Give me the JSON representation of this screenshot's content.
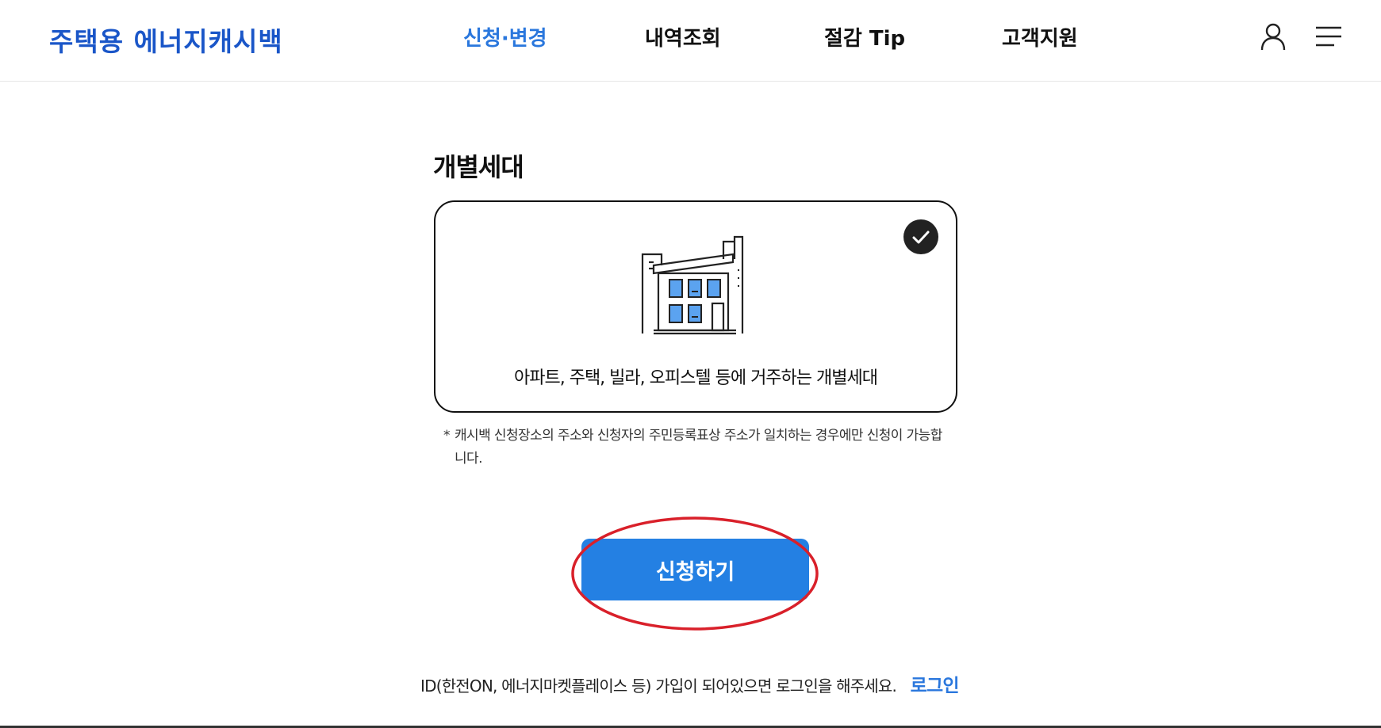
{
  "header": {
    "logo": "주택용 에너지캐시백",
    "nav": [
      {
        "label": "신청·변경",
        "active": true
      },
      {
        "label": "내역조회",
        "active": false
      },
      {
        "label": "절감 Tip",
        "active": false
      },
      {
        "label": "고객지원",
        "active": false
      }
    ],
    "icons": [
      "user-icon",
      "hamburger-menu-icon"
    ]
  },
  "main": {
    "section_title": "개별세대",
    "card": {
      "icon": "building-icon",
      "selected": true,
      "description": "아파트, 주택, 빌라, 오피스텔 등에 거주하는 개별세대"
    },
    "note_star": "*",
    "note": "캐시백 신청장소의 주소와 신청자의 주민등록표상 주소가 일치하는 경우에만 신청이 가능합니다.",
    "apply_button": "신청하기",
    "login_prompt": "ID(한전ON, 에너지마켓플레이스 등) 가입이 되어있으면 로그인을 해주세요.",
    "login_link": "로그인"
  },
  "colors": {
    "brand": "#1a56c8",
    "accent": "#2a77dd",
    "button": "#2480e3",
    "highlight": "#d9202a",
    "check_bg": "#222222"
  }
}
